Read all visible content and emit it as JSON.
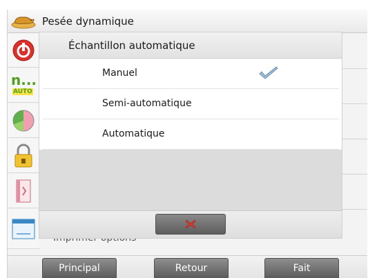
{
  "header": {
    "title": "Pesée dynamique",
    "icon": "animal-weighing-icon"
  },
  "sidebar": {
    "items": [
      {
        "icon": "power-icon",
        "color": "#d9322d"
      },
      {
        "icon": "auto-sample-icon",
        "text": "n...",
        "badge": "AUTO",
        "color": "#4f9f1f"
      },
      {
        "icon": "pie-chart-icon"
      },
      {
        "icon": "lock-settings-icon"
      },
      {
        "icon": "book-icon"
      },
      {
        "icon": "print-window-icon"
      }
    ]
  },
  "background_list": {
    "partial_row_text": "Imprimer options"
  },
  "dialog": {
    "title": "Échantillon automatique",
    "options": [
      {
        "label": "Manuel",
        "selected": true
      },
      {
        "label": "Semi-automatique",
        "selected": false
      },
      {
        "label": "Automatique",
        "selected": false
      }
    ],
    "cancel_icon": "x-icon",
    "cancel_color": "#e53b2f"
  },
  "nav": {
    "main_label": "Principal",
    "back_label": "Retour",
    "done_label": "Fait"
  }
}
